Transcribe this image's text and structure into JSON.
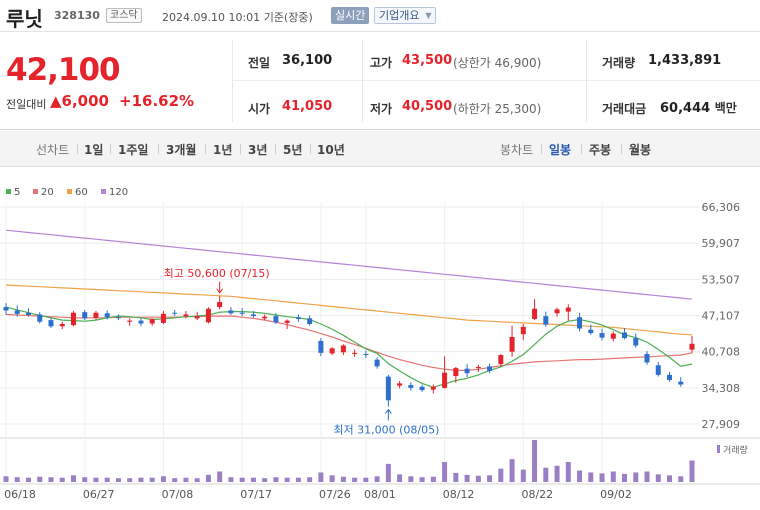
{
  "header": {
    "name": "루닛",
    "code": "328130",
    "market": "코스닥",
    "timestamp": "2024.09.10 10:01",
    "basis": "기준(장중)",
    "realtime": "실시간",
    "company_info": "기업개요"
  },
  "quote": {
    "price": "42,100",
    "change_label": "전일대비",
    "change": "6,000",
    "change_pct": "+16.62%",
    "prev_close_label": "전일",
    "prev_close": "36,100",
    "high_label": "고가",
    "high": "43,500",
    "upper_limit": "(상한가 46,900)",
    "volume_label": "거래량",
    "volume": "1,433,891",
    "open_label": "시가",
    "open": "41,050",
    "low_label": "저가",
    "low": "40,500",
    "lower_limit": "(하한가 25,300)",
    "amount_label": "거래대금",
    "amount": "60,444",
    "amount_unit": "백만"
  },
  "periods": {
    "line_label": "선차트",
    "line": [
      "1일",
      "1주일",
      "3개월",
      "1년",
      "3년",
      "5년",
      "10년"
    ],
    "candle_label": "봉차트",
    "candle": [
      "일봉",
      "주봉",
      "월봉"
    ],
    "active_candle": "일봉"
  },
  "colors": {
    "up": "#e4232b",
    "down": "#2d6fcf",
    "ma5": "#4caf50",
    "ma20": "#e87474",
    "ma60": "#f0a24a",
    "ma120": "#b484d6",
    "volume": "#9a7fc4"
  },
  "chart_data": {
    "type": "candlestick",
    "legend": [
      "5",
      "20",
      "60",
      "120"
    ],
    "y_ticks": [
      27909,
      34308,
      40708,
      47107,
      53507,
      59907,
      66306
    ],
    "y_tick_labels": [
      "27,909",
      "34,308",
      "40,708",
      "47,107",
      "53,507",
      "59,907",
      "66,306"
    ],
    "ylim": [
      27909,
      66306
    ],
    "x_tick_labels": [
      {
        "label": "06/18",
        "index": 0
      },
      {
        "label": "06/27",
        "index": 7
      },
      {
        "label": "07/08",
        "index": 14
      },
      {
        "label": "07/17",
        "index": 21
      },
      {
        "label": "07/26",
        "index": 28
      },
      {
        "label": "08/01",
        "index": 32
      },
      {
        "label": "08/12",
        "index": 39
      },
      {
        "label": "08/22",
        "index": 46
      },
      {
        "label": "09/02",
        "index": 53
      }
    ],
    "candles": [
      {
        "o": 48600,
        "h": 49300,
        "l": 47200,
        "c": 48000
      },
      {
        "o": 48000,
        "h": 48900,
        "l": 46900,
        "c": 47400
      },
      {
        "o": 47600,
        "h": 48400,
        "l": 46900,
        "c": 47200
      },
      {
        "o": 47300,
        "h": 47700,
        "l": 45700,
        "c": 46000
      },
      {
        "o": 46300,
        "h": 46700,
        "l": 44900,
        "c": 45200
      },
      {
        "o": 45200,
        "h": 46000,
        "l": 44700,
        "c": 45600
      },
      {
        "o": 45400,
        "h": 47900,
        "l": 45200,
        "c": 47600
      },
      {
        "o": 47700,
        "h": 48100,
        "l": 46300,
        "c": 46600
      },
      {
        "o": 46700,
        "h": 47900,
        "l": 46400,
        "c": 47600
      },
      {
        "o": 47500,
        "h": 48000,
        "l": 46400,
        "c": 46800
      },
      {
        "o": 46800,
        "h": 47300,
        "l": 46300,
        "c": 46700
      },
      {
        "o": 46000,
        "h": 46600,
        "l": 45300,
        "c": 46200
      },
      {
        "o": 46200,
        "h": 46600,
        "l": 45200,
        "c": 45700
      },
      {
        "o": 45700,
        "h": 46600,
        "l": 45300,
        "c": 46500
      },
      {
        "o": 45800,
        "h": 47900,
        "l": 45600,
        "c": 47400
      },
      {
        "o": 47600,
        "h": 48100,
        "l": 47000,
        "c": 47500
      },
      {
        "o": 47000,
        "h": 47900,
        "l": 46600,
        "c": 47300
      },
      {
        "o": 46600,
        "h": 47700,
        "l": 46300,
        "c": 47000
      },
      {
        "o": 45900,
        "h": 48600,
        "l": 45700,
        "c": 48300
      },
      {
        "o": 48600,
        "h": 50600,
        "l": 48200,
        "c": 49500
      },
      {
        "o": 48000,
        "h": 48600,
        "l": 47200,
        "c": 47500
      },
      {
        "o": 47600,
        "h": 48400,
        "l": 47000,
        "c": 47500
      },
      {
        "o": 47300,
        "h": 47900,
        "l": 46700,
        "c": 47000
      },
      {
        "o": 46600,
        "h": 47300,
        "l": 46300,
        "c": 46900
      },
      {
        "o": 47000,
        "h": 47500,
        "l": 45600,
        "c": 45900
      },
      {
        "o": 45800,
        "h": 46400,
        "l": 44700,
        "c": 46200
      },
      {
        "o": 46800,
        "h": 47300,
        "l": 46000,
        "c": 46500
      },
      {
        "o": 46600,
        "h": 47100,
        "l": 45300,
        "c": 45600
      },
      {
        "o": 42600,
        "h": 43100,
        "l": 39900,
        "c": 40500
      },
      {
        "o": 40400,
        "h": 41500,
        "l": 40100,
        "c": 41300
      },
      {
        "o": 40600,
        "h": 42000,
        "l": 40100,
        "c": 41800
      },
      {
        "o": 40300,
        "h": 41100,
        "l": 39800,
        "c": 40500
      },
      {
        "o": 40300,
        "h": 40900,
        "l": 39600,
        "c": 40200
      },
      {
        "o": 39300,
        "h": 39700,
        "l": 37700,
        "c": 38100
      },
      {
        "o": 36300,
        "h": 36600,
        "l": 31000,
        "c": 32100
      },
      {
        "o": 34700,
        "h": 35500,
        "l": 34200,
        "c": 35100
      },
      {
        "o": 34800,
        "h": 35300,
        "l": 33800,
        "c": 34300
      },
      {
        "o": 34500,
        "h": 34900,
        "l": 33600,
        "c": 33900
      },
      {
        "o": 34000,
        "h": 34900,
        "l": 33300,
        "c": 34500
      },
      {
        "o": 34300,
        "h": 39900,
        "l": 34200,
        "c": 37000
      },
      {
        "o": 36400,
        "h": 38000,
        "l": 35200,
        "c": 37800
      },
      {
        "o": 37700,
        "h": 38500,
        "l": 36200,
        "c": 36900
      },
      {
        "o": 37800,
        "h": 38400,
        "l": 37100,
        "c": 38000
      },
      {
        "o": 38100,
        "h": 38600,
        "l": 36900,
        "c": 37300
      },
      {
        "o": 38500,
        "h": 40300,
        "l": 38100,
        "c": 40100
      },
      {
        "o": 40700,
        "h": 45300,
        "l": 39800,
        "c": 43300
      },
      {
        "o": 43800,
        "h": 45600,
        "l": 42800,
        "c": 45100
      },
      {
        "o": 46500,
        "h": 50000,
        "l": 46300,
        "c": 48300
      },
      {
        "o": 47000,
        "h": 47800,
        "l": 45100,
        "c": 45500
      },
      {
        "o": 47500,
        "h": 48500,
        "l": 46900,
        "c": 48200
      },
      {
        "o": 47800,
        "h": 49100,
        "l": 46200,
        "c": 48500
      },
      {
        "o": 46800,
        "h": 47600,
        "l": 44300,
        "c": 44800
      },
      {
        "o": 44600,
        "h": 45500,
        "l": 43700,
        "c": 44000
      },
      {
        "o": 44000,
        "h": 44800,
        "l": 42700,
        "c": 43200
      },
      {
        "o": 43000,
        "h": 44300,
        "l": 42500,
        "c": 43900
      },
      {
        "o": 44100,
        "h": 44900,
        "l": 42900,
        "c": 43100
      },
      {
        "o": 43100,
        "h": 43900,
        "l": 41400,
        "c": 41800
      },
      {
        "o": 40300,
        "h": 40800,
        "l": 38400,
        "c": 38800
      },
      {
        "o": 38300,
        "h": 38900,
        "l": 36300,
        "c": 36600
      },
      {
        "o": 36600,
        "h": 37100,
        "l": 35400,
        "c": 35700
      },
      {
        "o": 35400,
        "h": 36200,
        "l": 34500,
        "c": 34900
      },
      {
        "o": 41050,
        "h": 43500,
        "l": 40500,
        "c": 42100
      }
    ],
    "volume": [
      12,
      10,
      9,
      11,
      10,
      9,
      14,
      10,
      9,
      9,
      8,
      8,
      9,
      9,
      12,
      8,
      9,
      8,
      15,
      22,
      10,
      9,
      9,
      8,
      10,
      9,
      9,
      10,
      20,
      14,
      11,
      9,
      9,
      12,
      38,
      16,
      12,
      10,
      11,
      42,
      19,
      15,
      13,
      14,
      28,
      48,
      26,
      88,
      30,
      34,
      42,
      24,
      20,
      18,
      22,
      17,
      20,
      22,
      16,
      14,
      12,
      45
    ],
    "ma5": [
      48600,
      48100,
      47600,
      47100,
      46700,
      46300,
      46200,
      46100,
      46300,
      46700,
      47000,
      46900,
      46700,
      46400,
      46500,
      46700,
      46900,
      47000,
      47200,
      47700,
      47800,
      47800,
      47700,
      47500,
      47200,
      46900,
      46700,
      46400,
      45600,
      44700,
      43600,
      42400,
      41200,
      40400,
      38600,
      37300,
      36100,
      35100,
      34400,
      35000,
      35600,
      36000,
      36600,
      37400,
      38000,
      39000,
      40200,
      42000,
      43800,
      45200,
      46100,
      46400,
      46000,
      45400,
      44600,
      43700,
      43200,
      42400,
      41100,
      39700,
      38100,
      38500
    ],
    "ma20": [
      47300,
      47200,
      47100,
      47000,
      46900,
      46800,
      46700,
      46700,
      46700,
      46700,
      46800,
      46800,
      46800,
      46800,
      46800,
      46800,
      46900,
      46900,
      47000,
      47000,
      47000,
      46800,
      46600,
      46300,
      45900,
      45500,
      45000,
      44500,
      43900,
      43300,
      42600,
      42000,
      41300,
      40600,
      39900,
      39300,
      38800,
      38300,
      37900,
      37600,
      37400,
      37400,
      37600,
      37900,
      38200,
      38500,
      38700,
      38900,
      39000,
      39100,
      39200,
      39300,
      39300,
      39400,
      39500,
      39600,
      39700,
      39800,
      39900,
      40000,
      40100,
      40500
    ],
    "ma60": [
      52500,
      52400,
      52300,
      52200,
      52100,
      52000,
      51900,
      51800,
      51700,
      51600,
      51500,
      51400,
      51300,
      51200,
      51100,
      51000,
      50900,
      50800,
      50700,
      50600,
      50500,
      50300,
      50100,
      49900,
      49700,
      49500,
      49300,
      49100,
      48900,
      48700,
      48500,
      48300,
      48100,
      47900,
      47700,
      47500,
      47300,
      47100,
      46900,
      46700,
      46500,
      46300,
      46200,
      46100,
      46000,
      45900,
      45800,
      45700,
      45600,
      45500,
      45400,
      45300,
      45200,
      45100,
      45000,
      44800,
      44600,
      44400,
      44200,
      44000,
      43800,
      43700
    ],
    "ma120": [
      62200,
      62000,
      61800,
      61600,
      61400,
      61200,
      61000,
      60800,
      60600,
      60400,
      60200,
      60000,
      59800,
      59600,
      59400,
      59200,
      59000,
      58800,
      58600,
      58400,
      58200,
      58000,
      57800,
      57600,
      57400,
      57200,
      57000,
      56800,
      56600,
      56400,
      56200,
      56000,
      55800,
      55600,
      55400,
      55200,
      55000,
      54800,
      54600,
      54400,
      54200,
      54000,
      53800,
      53600,
      53400,
      53200,
      53000,
      52800,
      52600,
      52400,
      52200,
      52000,
      51800,
      51600,
      51400,
      51200,
      51000,
      50800,
      50600,
      50400,
      50200,
      50000
    ],
    "annotations": [
      {
        "text": "최고 50,600 (07/15)",
        "index": 19,
        "value": 50600,
        "kind": "high"
      },
      {
        "text": "최저 31,000 (08/05)",
        "index": 34,
        "value": 31000,
        "kind": "low"
      }
    ],
    "volume_label": "거래량"
  }
}
